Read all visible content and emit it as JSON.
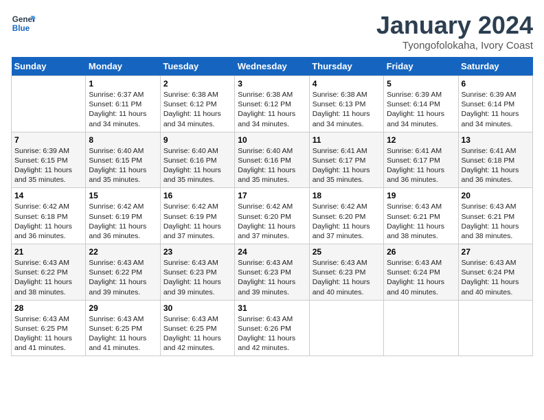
{
  "logo": {
    "line1": "General",
    "line2": "Blue"
  },
  "title": "January 2024",
  "subtitle": "Tyongofolokaha, Ivory Coast",
  "days_of_week": [
    "Sunday",
    "Monday",
    "Tuesday",
    "Wednesday",
    "Thursday",
    "Friday",
    "Saturday"
  ],
  "weeks": [
    [
      {
        "day": "",
        "text": ""
      },
      {
        "day": "1",
        "text": "Sunrise: 6:37 AM\nSunset: 6:11 PM\nDaylight: 11 hours\nand 34 minutes."
      },
      {
        "day": "2",
        "text": "Sunrise: 6:38 AM\nSunset: 6:12 PM\nDaylight: 11 hours\nand 34 minutes."
      },
      {
        "day": "3",
        "text": "Sunrise: 6:38 AM\nSunset: 6:12 PM\nDaylight: 11 hours\nand 34 minutes."
      },
      {
        "day": "4",
        "text": "Sunrise: 6:38 AM\nSunset: 6:13 PM\nDaylight: 11 hours\nand 34 minutes."
      },
      {
        "day": "5",
        "text": "Sunrise: 6:39 AM\nSunset: 6:14 PM\nDaylight: 11 hours\nand 34 minutes."
      },
      {
        "day": "6",
        "text": "Sunrise: 6:39 AM\nSunset: 6:14 PM\nDaylight: 11 hours\nand 34 minutes."
      }
    ],
    [
      {
        "day": "7",
        "text": "Sunrise: 6:39 AM\nSunset: 6:15 PM\nDaylight: 11 hours\nand 35 minutes."
      },
      {
        "day": "8",
        "text": "Sunrise: 6:40 AM\nSunset: 6:15 PM\nDaylight: 11 hours\nand 35 minutes."
      },
      {
        "day": "9",
        "text": "Sunrise: 6:40 AM\nSunset: 6:16 PM\nDaylight: 11 hours\nand 35 minutes."
      },
      {
        "day": "10",
        "text": "Sunrise: 6:40 AM\nSunset: 6:16 PM\nDaylight: 11 hours\nand 35 minutes."
      },
      {
        "day": "11",
        "text": "Sunrise: 6:41 AM\nSunset: 6:17 PM\nDaylight: 11 hours\nand 35 minutes."
      },
      {
        "day": "12",
        "text": "Sunrise: 6:41 AM\nSunset: 6:17 PM\nDaylight: 11 hours\nand 36 minutes."
      },
      {
        "day": "13",
        "text": "Sunrise: 6:41 AM\nSunset: 6:18 PM\nDaylight: 11 hours\nand 36 minutes."
      }
    ],
    [
      {
        "day": "14",
        "text": "Sunrise: 6:42 AM\nSunset: 6:18 PM\nDaylight: 11 hours\nand 36 minutes."
      },
      {
        "day": "15",
        "text": "Sunrise: 6:42 AM\nSunset: 6:19 PM\nDaylight: 11 hours\nand 36 minutes."
      },
      {
        "day": "16",
        "text": "Sunrise: 6:42 AM\nSunset: 6:19 PM\nDaylight: 11 hours\nand 37 minutes."
      },
      {
        "day": "17",
        "text": "Sunrise: 6:42 AM\nSunset: 6:20 PM\nDaylight: 11 hours\nand 37 minutes."
      },
      {
        "day": "18",
        "text": "Sunrise: 6:42 AM\nSunset: 6:20 PM\nDaylight: 11 hours\nand 37 minutes."
      },
      {
        "day": "19",
        "text": "Sunrise: 6:43 AM\nSunset: 6:21 PM\nDaylight: 11 hours\nand 38 minutes."
      },
      {
        "day": "20",
        "text": "Sunrise: 6:43 AM\nSunset: 6:21 PM\nDaylight: 11 hours\nand 38 minutes."
      }
    ],
    [
      {
        "day": "21",
        "text": "Sunrise: 6:43 AM\nSunset: 6:22 PM\nDaylight: 11 hours\nand 38 minutes."
      },
      {
        "day": "22",
        "text": "Sunrise: 6:43 AM\nSunset: 6:22 PM\nDaylight: 11 hours\nand 39 minutes."
      },
      {
        "day": "23",
        "text": "Sunrise: 6:43 AM\nSunset: 6:23 PM\nDaylight: 11 hours\nand 39 minutes."
      },
      {
        "day": "24",
        "text": "Sunrise: 6:43 AM\nSunset: 6:23 PM\nDaylight: 11 hours\nand 39 minutes."
      },
      {
        "day": "25",
        "text": "Sunrise: 6:43 AM\nSunset: 6:23 PM\nDaylight: 11 hours\nand 40 minutes."
      },
      {
        "day": "26",
        "text": "Sunrise: 6:43 AM\nSunset: 6:24 PM\nDaylight: 11 hours\nand 40 minutes."
      },
      {
        "day": "27",
        "text": "Sunrise: 6:43 AM\nSunset: 6:24 PM\nDaylight: 11 hours\nand 40 minutes."
      }
    ],
    [
      {
        "day": "28",
        "text": "Sunrise: 6:43 AM\nSunset: 6:25 PM\nDaylight: 11 hours\nand 41 minutes."
      },
      {
        "day": "29",
        "text": "Sunrise: 6:43 AM\nSunset: 6:25 PM\nDaylight: 11 hours\nand 41 minutes."
      },
      {
        "day": "30",
        "text": "Sunrise: 6:43 AM\nSunset: 6:25 PM\nDaylight: 11 hours\nand 42 minutes."
      },
      {
        "day": "31",
        "text": "Sunrise: 6:43 AM\nSunset: 6:26 PM\nDaylight: 11 hours\nand 42 minutes."
      },
      {
        "day": "",
        "text": ""
      },
      {
        "day": "",
        "text": ""
      },
      {
        "day": "",
        "text": ""
      }
    ]
  ]
}
